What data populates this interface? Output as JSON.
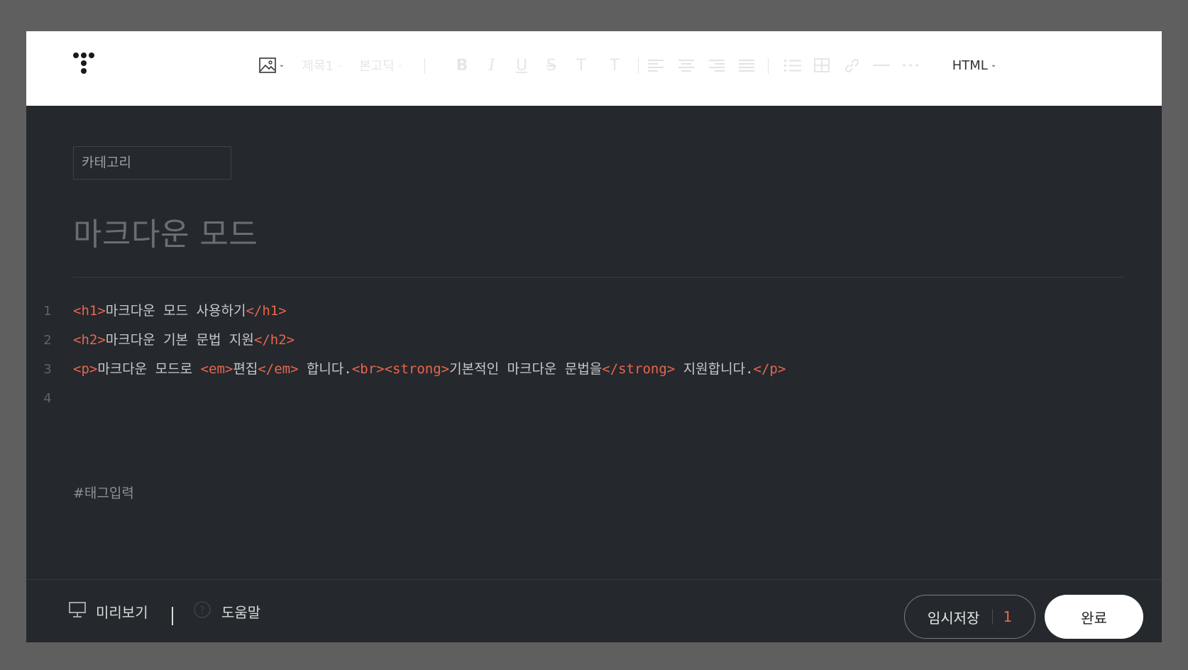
{
  "toolbar": {
    "heading_label": "제목1",
    "font_label": "본고딕",
    "mode_label": "HTML",
    "buttons": {
      "bold": "B",
      "italic": "I",
      "underline": "U",
      "strike": "S",
      "text_color": "T",
      "bg_color": "T"
    }
  },
  "editor": {
    "category_placeholder": "카테고리",
    "title_placeholder": "마크다운 모드",
    "tag_placeholder": "#태그입력",
    "lines": [
      {
        "number": "1",
        "segments": [
          {
            "t": "<h1>",
            "tag": true
          },
          {
            "t": "마크다운 모드 사용하기",
            "tag": false
          },
          {
            "t": "</h1>",
            "tag": true
          }
        ]
      },
      {
        "number": "2",
        "segments": [
          {
            "t": "<h2>",
            "tag": true
          },
          {
            "t": "마크다운 기본 문법 지원",
            "tag": false
          },
          {
            "t": "</h2>",
            "tag": true
          }
        ]
      },
      {
        "number": "3",
        "segments": [
          {
            "t": "<p>",
            "tag": true
          },
          {
            "t": "마크다운 모드로 ",
            "tag": false
          },
          {
            "t": "<em>",
            "tag": true
          },
          {
            "t": "편집",
            "tag": false
          },
          {
            "t": "</em>",
            "tag": true
          },
          {
            "t": " 합니다.",
            "tag": false
          },
          {
            "t": "<br><strong>",
            "tag": true
          },
          {
            "t": "기본적인 마크다운 문법을",
            "tag": false
          },
          {
            "t": "</strong>",
            "tag": true
          },
          {
            "t": " 지원합니다.",
            "tag": false
          },
          {
            "t": "</p>",
            "tag": true
          }
        ]
      },
      {
        "number": "4",
        "segments": []
      }
    ]
  },
  "footer": {
    "preview_label": "미리보기",
    "help_label": "도움말",
    "draft_label": "임시저장",
    "draft_count": "1",
    "done_label": "완료"
  },
  "colors": {
    "accent": "#e8664e",
    "editor_bg": "#25282d",
    "toolbar_bg": "#ffffff"
  }
}
